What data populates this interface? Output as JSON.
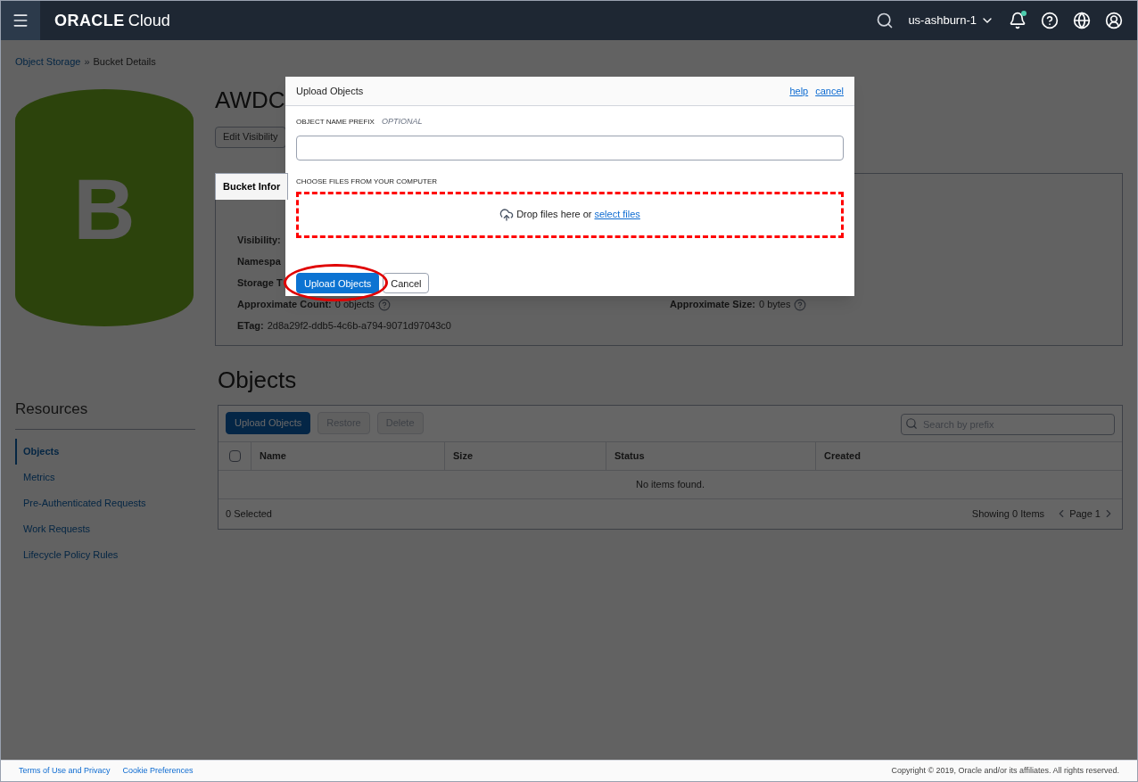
{
  "header": {
    "logo_bold": "ORACLE",
    "logo_light": "Cloud",
    "region": "us-ashburn-1",
    "has_notification": true
  },
  "breadcrumb": {
    "items": [
      "Object Storage",
      "Bucket Details"
    ],
    "separator": "»"
  },
  "bucket": {
    "logo_letter": "B",
    "title": "AWDC",
    "edit_button": "Edit Visibility",
    "tab": "Bucket Infor",
    "fields": [
      {
        "label": "Visibility:"
      },
      {
        "label": "Namespa"
      },
      {
        "label": "Storage T"
      },
      {
        "label": "Approximate Count:",
        "value": "0 objects",
        "help": true
      },
      {
        "label": "ETag:",
        "value": "2d8a29f2-ddb5-4c6b-a794-9071d97043c0"
      }
    ],
    "side_fields": [
      {
        "label": "Approximate Size:",
        "value": "0 bytes",
        "help": true
      }
    ]
  },
  "resources": {
    "title": "Resources",
    "items": [
      {
        "label": "Objects",
        "selected": true
      },
      {
        "label": "Metrics",
        "selected": false
      },
      {
        "label": "Pre-Authenticated Requests",
        "selected": false
      },
      {
        "label": "Work Requests",
        "selected": false
      },
      {
        "label": "Lifecycle Policy Rules",
        "selected": false
      }
    ]
  },
  "objects": {
    "title": "Objects",
    "buttons": [
      {
        "label": "Upload Objects",
        "disabled": false
      },
      {
        "label": "Restore",
        "disabled": true
      },
      {
        "label": "Delete",
        "disabled": true
      }
    ],
    "search": {
      "placeholder": "Search by prefix"
    },
    "select_all": {
      "checked": false
    },
    "columns": [
      "Name",
      "Size",
      "Status",
      "Created"
    ],
    "empty": "No items found.",
    "selected_count": "0 Selected",
    "showing": "Showing 0 Items",
    "page": "Page 1"
  },
  "modal": {
    "title": "Upload Objects",
    "links": [
      "help",
      "cancel"
    ],
    "prefix_label": "OBJECT NAME PREFIX",
    "prefix_hint": "OPTIONAL",
    "files_label": "CHOOSE FILES FROM YOUR COMPUTER",
    "drop_text": "Drop files here or",
    "drop_link": "select files",
    "buttons": [
      {
        "label": "Upload Objects",
        "kind": "primary",
        "highlighted": true
      },
      {
        "label": "Cancel",
        "kind": "secondary",
        "highlighted": false
      }
    ]
  },
  "footer": {
    "links": [
      "Terms of Use and Privacy",
      "Cookie Preferences"
    ],
    "copyright": "Copyright © 2019, Oracle and/or its affiliates. All rights reserved."
  }
}
